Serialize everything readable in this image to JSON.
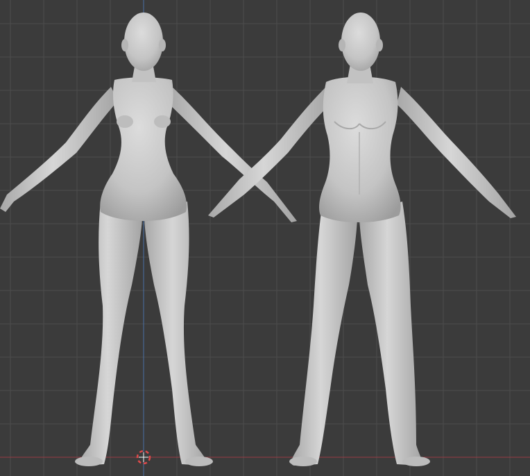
{
  "viewport": {
    "background_color": "#3b3b3b",
    "grid_color": "#4d4d4d",
    "axis_x_color": "#9a3b44",
    "axis_z_color": "#4a6fa5",
    "cursor_color_red": "#e04a4a",
    "cursor_color_white": "#ffffff"
  },
  "models": [
    {
      "name": "female-base-mesh",
      "pose": "A-pose",
      "material_color": "#c9c9c9"
    },
    {
      "name": "male-base-mesh",
      "pose": "A-pose",
      "material_color": "#c9c9c9"
    }
  ],
  "icons": {
    "cursor": "3d-cursor-icon"
  }
}
